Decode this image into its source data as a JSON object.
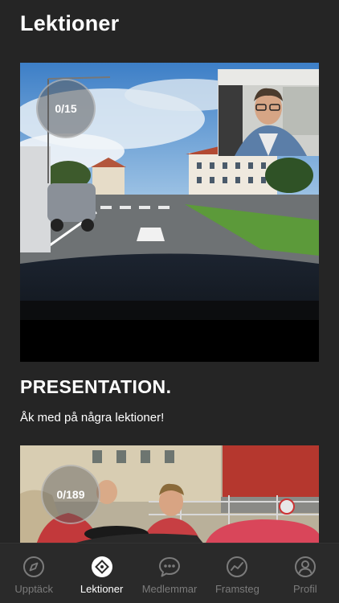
{
  "header": {
    "title": "Lektioner"
  },
  "lessons": [
    {
      "progress": "0/15",
      "title": "PRESENTATION.",
      "subtitle": "Åk med på några lektioner!"
    },
    {
      "progress": "0/189"
    }
  ],
  "nav": {
    "items": [
      {
        "label": "Upptäck",
        "icon": "compass-icon",
        "active": false
      },
      {
        "label": "Lektioner",
        "icon": "lessons-icon",
        "active": true
      },
      {
        "label": "Medlemmar",
        "icon": "chat-bubble-icon",
        "active": false
      },
      {
        "label": "Framsteg",
        "icon": "progress-graph-icon",
        "active": false
      },
      {
        "label": "Profil",
        "icon": "user-icon",
        "active": false
      }
    ]
  },
  "colors": {
    "background": "#252525",
    "nav_background": "#2a2a2a",
    "nav_active": "#ffffff",
    "nav_inactive": "#7b7b7b"
  }
}
